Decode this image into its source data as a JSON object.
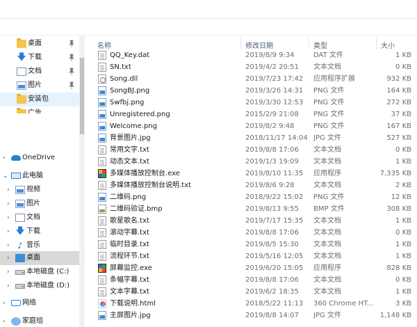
{
  "nav": {
    "items": [
      {
        "label": "桌面",
        "icon": "folder-icon",
        "pinned": true
      },
      {
        "label": "下载",
        "icon": "download-icon",
        "pinned": true
      },
      {
        "label": "文档",
        "icon": "documents-icon",
        "pinned": true
      },
      {
        "label": "图片",
        "icon": "pictures-icon",
        "pinned": true
      },
      {
        "label": "安装包",
        "icon": "folder-icon",
        "pinned": false
      },
      {
        "label": "广告",
        "icon": "folder-icon",
        "pinned": false
      },
      {
        "label": "OneDrive",
        "icon": "cloud-icon"
      },
      {
        "label": "此电脑",
        "icon": "computer-icon"
      },
      {
        "label": "视频",
        "icon": "videos-icon"
      },
      {
        "label": "图片",
        "icon": "pictures-icon"
      },
      {
        "label": "文档",
        "icon": "documents-icon"
      },
      {
        "label": "下载",
        "icon": "download-icon"
      },
      {
        "label": "音乐",
        "icon": "music-icon"
      },
      {
        "label": "桌面",
        "icon": "desktop-icon"
      },
      {
        "label": "本地磁盘 (C:)",
        "icon": "drive-icon"
      },
      {
        "label": "本地磁盘 (D:)",
        "icon": "drive-icon"
      },
      {
        "label": "网络",
        "icon": "network-icon"
      },
      {
        "label": "家庭组",
        "icon": "homegroup-icon"
      }
    ]
  },
  "columns": {
    "name": "名称",
    "date": "修改日期",
    "type": "类型",
    "size": "大小"
  },
  "files": [
    {
      "name": "QQ_Key.dat",
      "date": "2019/8/9 9:34",
      "type": "DAT 文件",
      "size": "1 KB",
      "icon": "file-icon"
    },
    {
      "name": "SN.txt",
      "date": "2019/4/2 20:51",
      "type": "文本文档",
      "size": "0 KB",
      "icon": "text-file-icon"
    },
    {
      "name": "Song.dll",
      "date": "2019/7/23 17:42",
      "type": "应用程序扩展",
      "size": "932 KB",
      "icon": "dll-icon"
    },
    {
      "name": "SongBJ.png",
      "date": "2019/3/26 14:31",
      "type": "PNG 文件",
      "size": "164 KB",
      "icon": "image-icon"
    },
    {
      "name": "Swfbj.png",
      "date": "2019/3/30 12:53",
      "type": "PNG 文件",
      "size": "272 KB",
      "icon": "image-icon"
    },
    {
      "name": "Unregistered.png",
      "date": "2015/2/9 21:08",
      "type": "PNG 文件",
      "size": "37 KB",
      "icon": "image-icon"
    },
    {
      "name": "Welcome.png",
      "date": "2019/8/2 9:48",
      "type": "PNG 文件",
      "size": "167 KB",
      "icon": "image-icon"
    },
    {
      "name": "背景图片.jpg",
      "date": "2018/11/17 14:04",
      "type": "JPG 文件",
      "size": "527 KB",
      "icon": "image-icon"
    },
    {
      "name": "常用文字.txt",
      "date": "2019/8/8 17:06",
      "type": "文本文档",
      "size": "0 KB",
      "icon": "text-file-icon"
    },
    {
      "name": "动态文本.txt",
      "date": "2019/1/3 19:09",
      "type": "文本文档",
      "size": "1 KB",
      "icon": "text-file-icon"
    },
    {
      "name": "多媒体播放控制台.exe",
      "date": "2019/8/10 11:35",
      "type": "应用程序",
      "size": "7,335 KB",
      "icon": "app-icon"
    },
    {
      "name": "多媒体播放控制台说明.txt",
      "date": "2019/8/6 9:28",
      "type": "文本文档",
      "size": "2 KB",
      "icon": "text-file-icon"
    },
    {
      "name": "二维码.png",
      "date": "2018/9/22 15:02",
      "type": "PNG 文件",
      "size": "12 KB",
      "icon": "image-icon"
    },
    {
      "name": "二维码验证.bmp",
      "date": "2019/8/13 9:55",
      "type": "BMP 文件",
      "size": "308 KB",
      "icon": "bitmap-icon"
    },
    {
      "name": "歌星歌名.txt",
      "date": "2019/7/17 15:35",
      "type": "文本文档",
      "size": "1 KB",
      "icon": "text-file-icon"
    },
    {
      "name": "滚动字幕.txt",
      "date": "2019/8/8 17:06",
      "type": "文本文档",
      "size": "0 KB",
      "icon": "text-file-icon"
    },
    {
      "name": "临时目录.txt",
      "date": "2019/8/5 15:30",
      "type": "文本文档",
      "size": "1 KB",
      "icon": "text-file-icon"
    },
    {
      "name": "流程环节.txt",
      "date": "2019/5/16 12:05",
      "type": "文本文档",
      "size": "1 KB",
      "icon": "text-file-icon"
    },
    {
      "name": "屏幕监控.exe",
      "date": "2019/6/20 15:05",
      "type": "应用程序",
      "size": "828 KB",
      "icon": "app-icon"
    },
    {
      "name": "条幅字幕.txt",
      "date": "2019/8/8 17:06",
      "type": "文本文档",
      "size": "0 KB",
      "icon": "text-file-icon"
    },
    {
      "name": "文本字幕.txt",
      "date": "2019/6/2 18:35",
      "type": "文本文档",
      "size": "1 KB",
      "icon": "text-file-icon"
    },
    {
      "name": "下载说明.html",
      "date": "2018/5/22 11:13",
      "type": "360 Chrome HT...",
      "size": "3 KB",
      "icon": "html-icon"
    },
    {
      "name": "主屏图片.jpg",
      "date": "2019/8/8 14:07",
      "type": "JPG 文件",
      "size": "1,148 KB",
      "icon": "image-icon"
    }
  ]
}
